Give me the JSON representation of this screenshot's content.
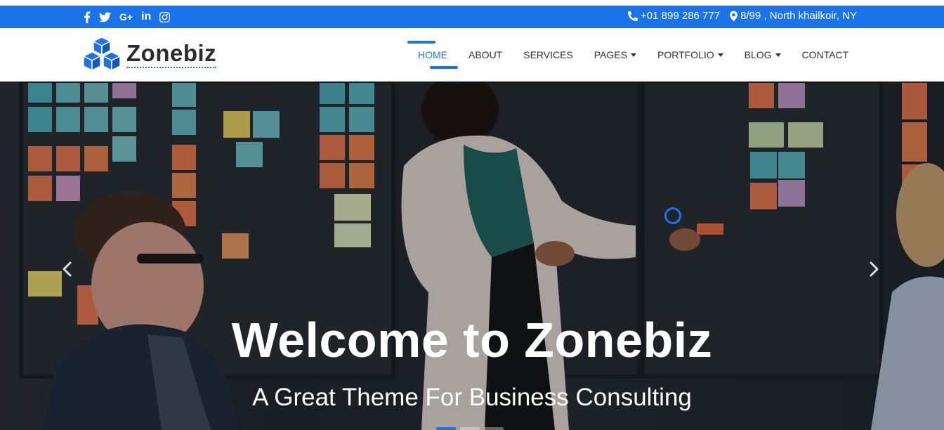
{
  "topbar": {
    "social": [
      {
        "name": "facebook",
        "icon": "facebook-icon"
      },
      {
        "name": "twitter",
        "icon": "twitter-icon"
      },
      {
        "name": "google-plus",
        "icon": "google-plus-icon",
        "label": "G+"
      },
      {
        "name": "linkedin",
        "icon": "linkedin-icon",
        "label": "in"
      },
      {
        "name": "instagram",
        "icon": "instagram-icon"
      }
    ],
    "phone": "+01 899 286 777",
    "address": "8/99 , North khailkoir, NY",
    "bg_color": "#1a73e8"
  },
  "brand": {
    "name": "Zonebiz",
    "accent": "#1a73e8"
  },
  "nav": {
    "items": [
      {
        "label": "HOME",
        "active": true,
        "dropdown": false
      },
      {
        "label": "ABOUT",
        "active": false,
        "dropdown": false
      },
      {
        "label": "SERVICES",
        "active": false,
        "dropdown": false
      },
      {
        "label": "PAGES",
        "active": false,
        "dropdown": true
      },
      {
        "label": "PORTFOLIO",
        "active": false,
        "dropdown": true
      },
      {
        "label": "BLOG",
        "active": false,
        "dropdown": true
      },
      {
        "label": "CONTACT",
        "active": false,
        "dropdown": false
      }
    ]
  },
  "hero": {
    "title": "Welcome to Zonebiz",
    "subtitle": "A Great Theme For Business Consulting",
    "slide_count": 3,
    "active_slide": 1
  }
}
